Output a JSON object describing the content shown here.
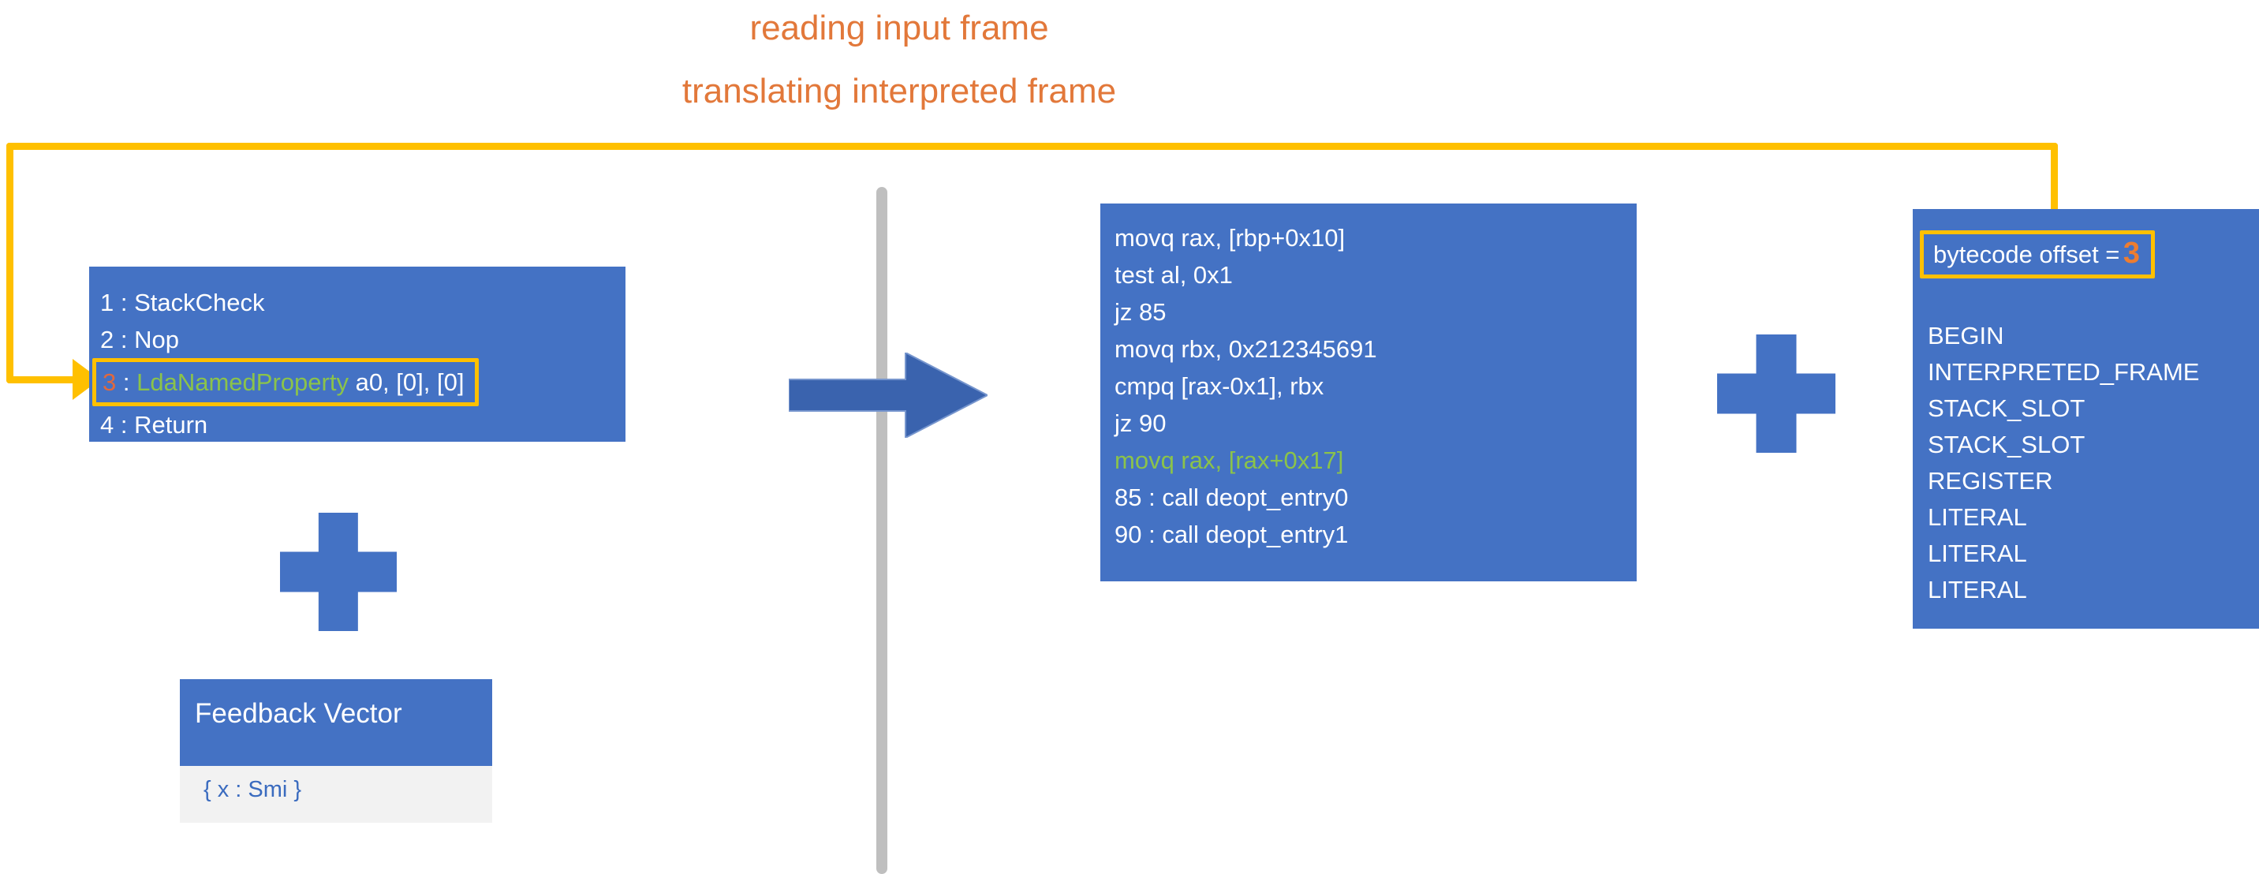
{
  "titles": {
    "line1": "reading input frame",
    "line2": "translating interpreted frame"
  },
  "colors": {
    "panel_blue": "#4472C4",
    "highlight_amber": "#FFC000",
    "title_orange": "#E2783A",
    "hot_opcode_green": "#8BC34A",
    "hot_line_orange": "#E2683C",
    "offset_orange": "#ED7D31",
    "divider_gray": "#BFBFBF",
    "card_body_gray": "#F2F2F2",
    "feedback_value_blue": "#3A6BBF"
  },
  "bytecode_panel": {
    "name": "bytecode listing",
    "lines": [
      {
        "index": "1",
        "separator": ":",
        "opcode": "StackCheck",
        "operands": "",
        "highlighted": false
      },
      {
        "index": "2",
        "separator": ":",
        "opcode": "Nop",
        "operands": "",
        "highlighted": false
      },
      {
        "index": "3",
        "separator": ":",
        "opcode": "LdaNamedProperty",
        "operands": "a0, [0], [0]",
        "highlighted": true
      },
      {
        "index": "4",
        "separator": ":",
        "opcode": "Return",
        "operands": "",
        "highlighted": false
      }
    ]
  },
  "feedback_vector": {
    "title": "Feedback Vector",
    "value": "{ x : Smi }"
  },
  "assembly_panel": {
    "lines": [
      {
        "text": "movq rax, [rbp+0x10]",
        "highlighted": false
      },
      {
        "text": "test al, 0x1",
        "highlighted": false
      },
      {
        "text": "jz 85",
        "highlighted": false
      },
      {
        "text": "movq rbx, 0x212345691",
        "highlighted": false
      },
      {
        "text": "cmpq [rax-0x1], rbx",
        "highlighted": false
      },
      {
        "text": "jz 90",
        "highlighted": false
      },
      {
        "text": "movq rax, [rax+0x17]",
        "highlighted": true
      },
      {
        "text": "85 : call deopt_entry0",
        "highlighted": false
      },
      {
        "text": "90 : call deopt_entry1",
        "highlighted": false
      }
    ]
  },
  "frame_panel": {
    "offset_label": "bytecode offset =",
    "offset_value": "3",
    "translation_opcodes": [
      "BEGIN",
      "INTERPRETED_FRAME",
      "STACK_SLOT",
      "STACK_SLOT",
      "REGISTER",
      "LITERAL",
      "LITERAL",
      "LITERAL"
    ]
  },
  "symbols": {
    "plus_left": "+",
    "plus_right": "+",
    "flow_arrow": "right-arrow"
  }
}
